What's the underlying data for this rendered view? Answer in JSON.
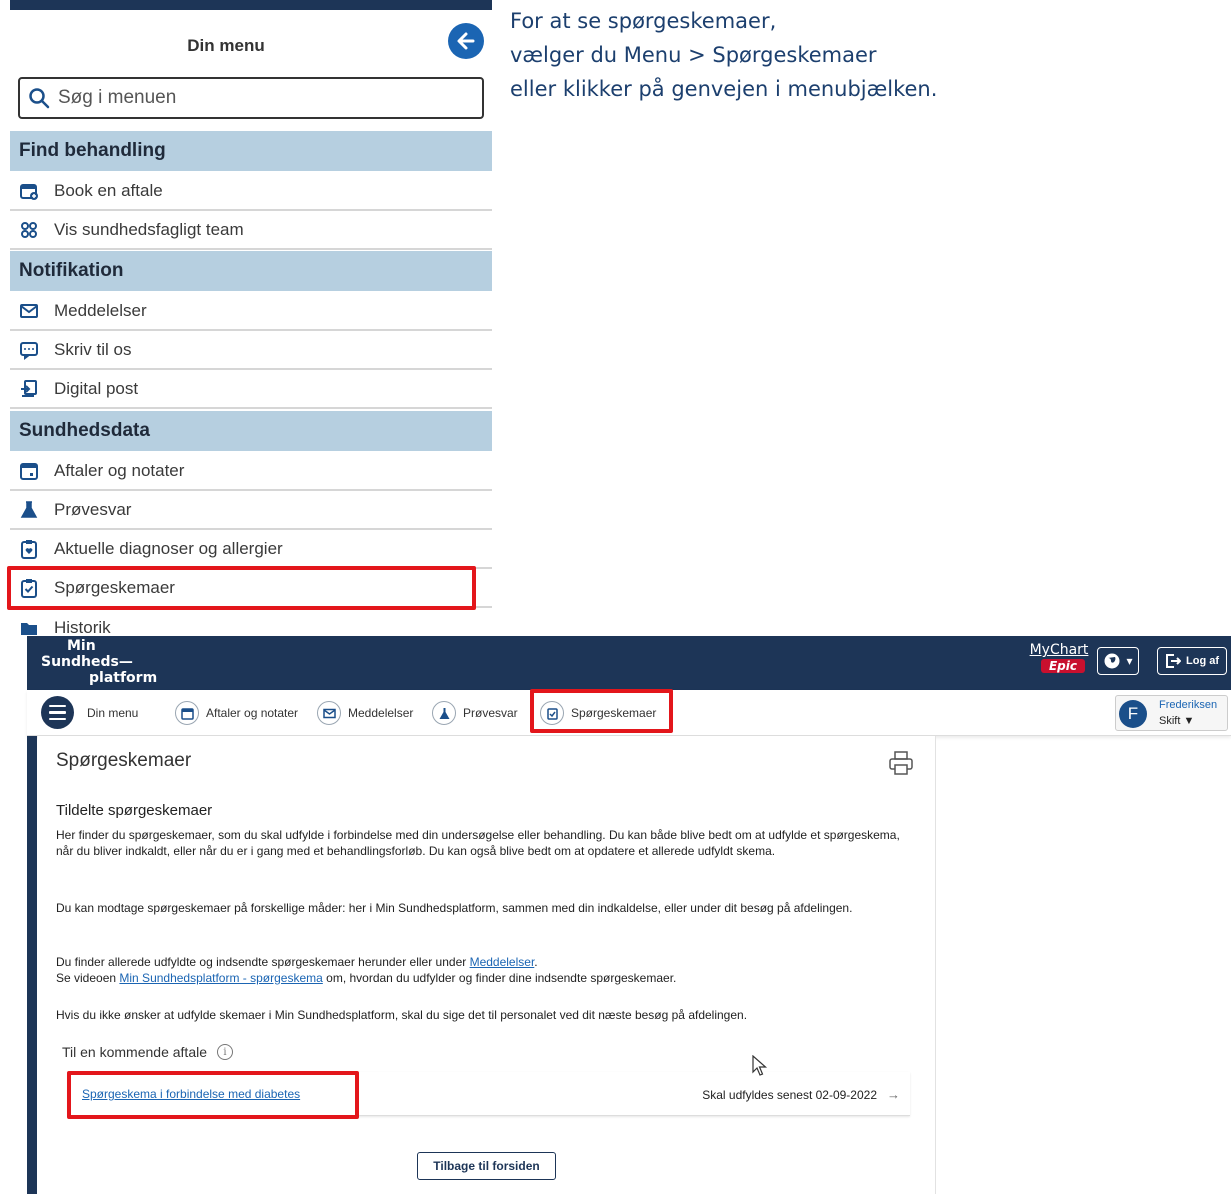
{
  "menu": {
    "title": "Din menu",
    "search_placeholder": "Søg i menuen",
    "sections": [
      {
        "label": "Find behandling",
        "items": [
          "Book en aftale",
          "Vis sundhedsfagligt team"
        ]
      },
      {
        "label": "Notifikation",
        "items": [
          "Meddelelser",
          "Skriv til os",
          "Digital post"
        ]
      },
      {
        "label": "Sundhedsdata",
        "items": [
          "Aftaler og notater",
          "Prøvesvar",
          "Aktuelle diagnoser og allergier",
          "Spørgeskemaer",
          "Historik"
        ]
      }
    ]
  },
  "instructions": [
    "For at se spørgeskemaer,",
    "vælger du Menu > Spørgeskemaer",
    "eller klikker på genvejen i menubjælken."
  ],
  "header": {
    "brand_line1": "Min",
    "brand_line2": "Sundheds—",
    "brand_line3": "platform",
    "mychart": "MyChart",
    "epic": "Epic",
    "logout_label": "Log af"
  },
  "nav": {
    "menu_label": "Din menu",
    "items": [
      "Aftaler og notater",
      "Meddelelser",
      "Prøvesvar",
      "Spørgeskemaer"
    ],
    "user_name": "Frederiksen",
    "user_switch": "Skift",
    "user_initial": "F"
  },
  "page": {
    "title": "Spørgeskemaer",
    "assigned_heading": "Tildelte spørgeskemaer",
    "para1": "Her finder du spørgeskemaer, som du skal udfylde i forbindelse med din undersøgelse eller behandling. Du kan både blive bedt om at udfylde et spørgeskema, når du bliver indkaldt, eller når du er i gang med et behandlingsforløb. Du kan også blive bedt om at opdatere et allerede udfyldt skema.",
    "para2": "Du kan modtage spørgeskemaer på forskellige måder: her i Min Sundhedsplatform, sammen med din indkaldelse, eller under dit besøg på afdelingen.",
    "para3_prefix": "Du finder allerede udfyldte og indsendte spørgeskemaer herunder eller under ",
    "para3_link": "Meddelelser",
    "para3_suffix": ".",
    "para4_prefix": "Se videoen ",
    "para4_link": "Min Sundhedsplatform - spørgeskema",
    "para4_suffix": " om, hvordan du udfylder og finder dine indsendte spørgeskemaer.",
    "para5": "Hvis du ikke ønsker at udfylde skemaer i Min Sundhedsplatform, skal du sige det til personalet ved dit næste besøg på afdelingen.",
    "upcoming_heading": "Til en kommende aftale",
    "info_symbol": "i",
    "questionnaire_title": "Spørgeskema i forbindelse med diabetes",
    "deadline": "Skal udfyldes senest 02-09-2022",
    "arrow": "→",
    "back_button": "Tilbage til forsiden"
  },
  "colors": {
    "navy": "#1d3557",
    "link": "#1b65b3",
    "highlight": "#e3161b",
    "section_bg": "#b6cfe0"
  }
}
